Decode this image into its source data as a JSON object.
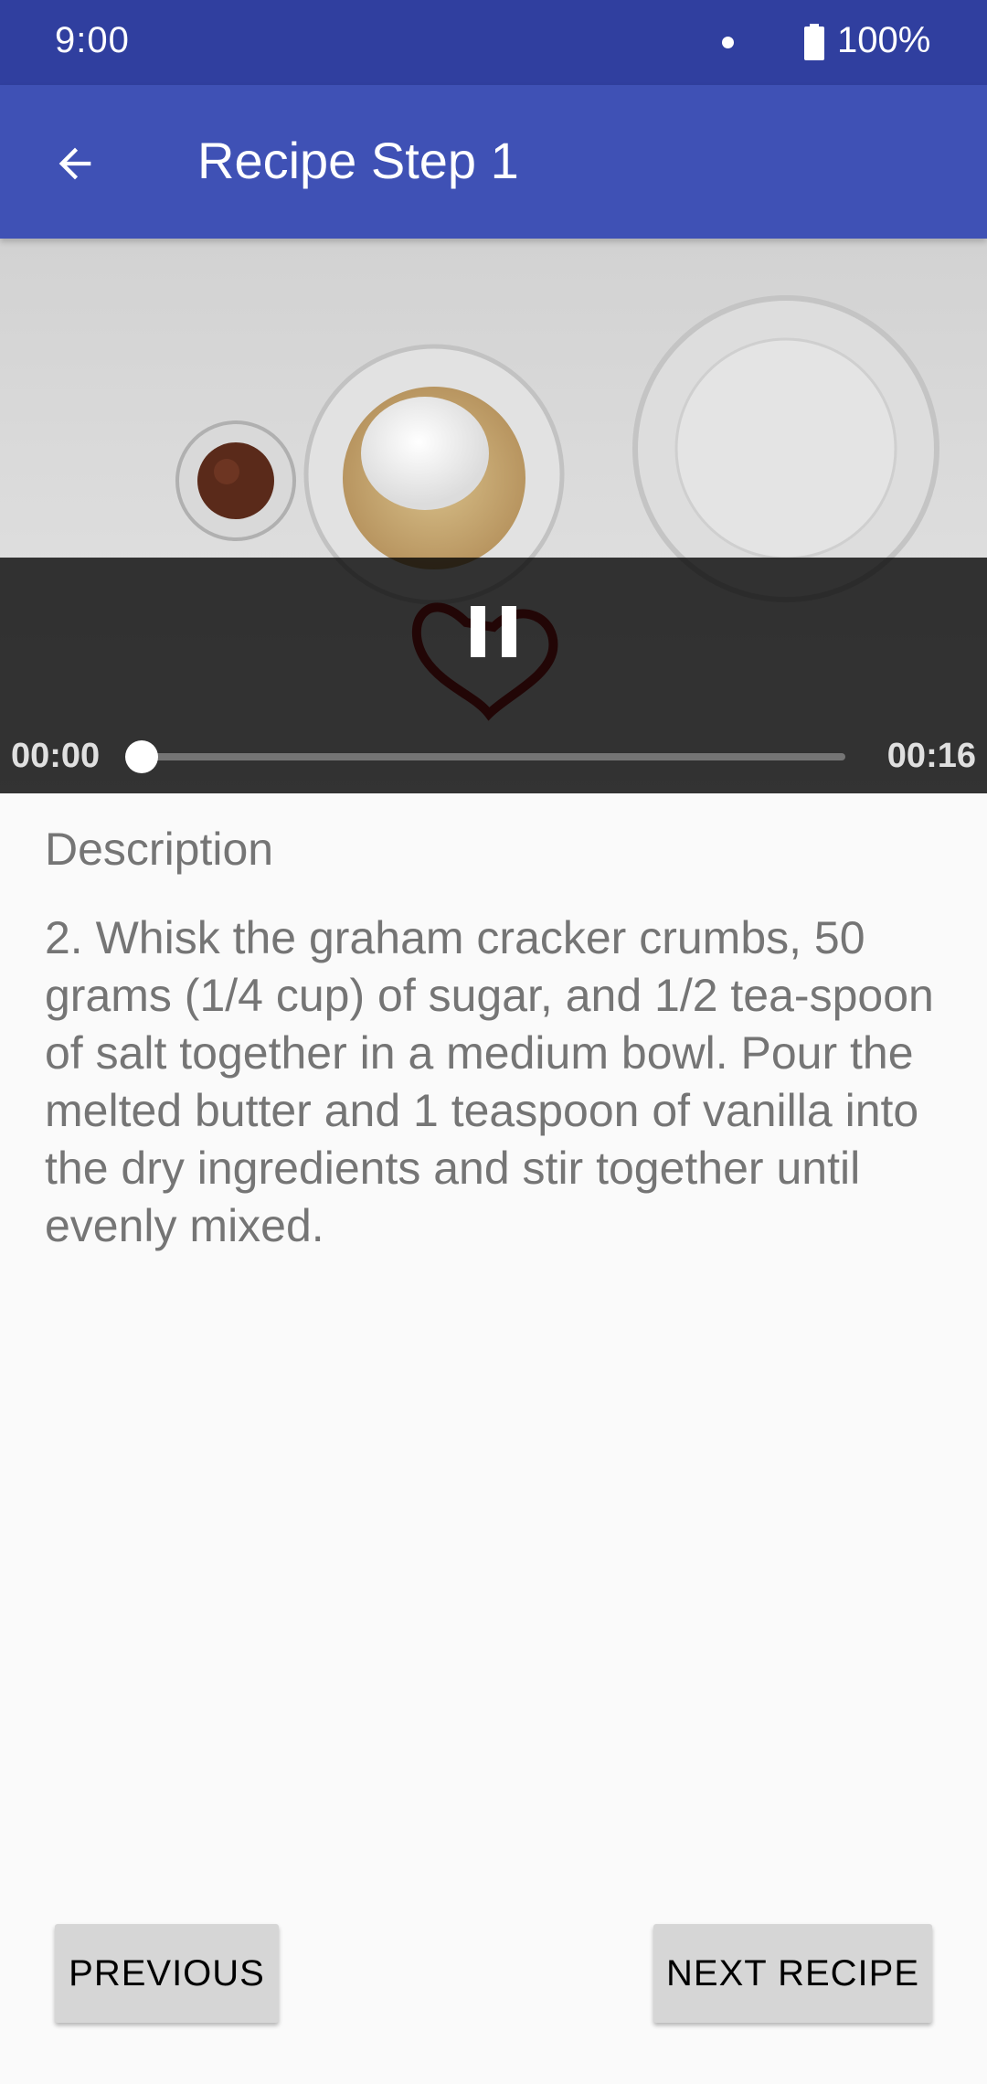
{
  "status_bar": {
    "time": "9:00",
    "battery": "100%"
  },
  "app_bar": {
    "title": "Recipe Step 1",
    "back_icon": "arrow-back-icon"
  },
  "player": {
    "current_time": "00:00",
    "total_time": "00:16",
    "progress": 0,
    "state_icon": "pause-icon"
  },
  "description": {
    "label": "Description",
    "text": "2. Whisk the graham cracker crumbs, 50 grams (1/4 cup) of sugar, and 1/2 tea-spoon of salt together in a medium bowl. Pour the melted butter and 1 teaspoon of vanilla into the dry ingredients and stir together until evenly mixed."
  },
  "buttons": {
    "previous": "PREVIOUS",
    "next": "NEXT RECIPE"
  },
  "colors": {
    "status_bar": "#303f9f",
    "app_bar": "#3f51b5",
    "background": "#fafafa",
    "button": "#d6d6d6"
  }
}
